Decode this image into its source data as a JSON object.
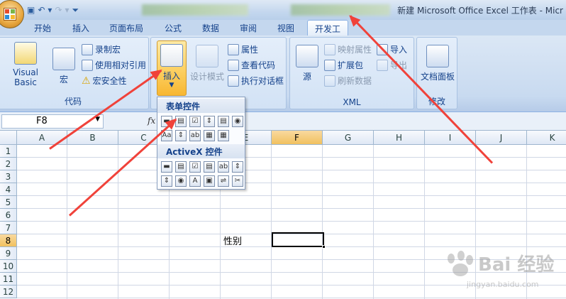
{
  "window": {
    "title": "新建 Microsoft Office Excel 工作表 - Micr"
  },
  "tabs": [
    "开始",
    "插入",
    "页面布局",
    "公式",
    "数据",
    "审阅",
    "视图",
    "开发工"
  ],
  "ribbon": {
    "code_group": {
      "label": "代码",
      "visual_basic": "Visual Basic",
      "macro": "宏",
      "record_macro": "录制宏",
      "relative_ref": "使用相对引用",
      "macro_security": "宏安全性"
    },
    "controls_group": {
      "insert": "插入",
      "design_mode": "设计模式",
      "properties": "属性",
      "view_code": "查看代码",
      "run_dialog": "执行对话框"
    },
    "xml_group": {
      "label": "XML",
      "source": "源",
      "map_props": "映射属性",
      "expansion_packs": "扩展包",
      "refresh_data": "刷新数据",
      "import": "导入",
      "export": "导出"
    },
    "modify_group": {
      "label": "修改",
      "doc_panel": "文档面板"
    }
  },
  "formula_bar": {
    "name_box": "F8",
    "fx": "fx"
  },
  "popup": {
    "form_controls": "表单控件",
    "activex_controls": "ActiveX 控件"
  },
  "sheet": {
    "columns": [
      "A",
      "B",
      "C",
      "D",
      "E",
      "F",
      "G",
      "H",
      "I",
      "J",
      "K"
    ],
    "rows": [
      "1",
      "2",
      "3",
      "4",
      "5",
      "6",
      "7",
      "8",
      "9",
      "10",
      "11",
      "12"
    ],
    "cell_E8": "性别",
    "selected_cell": "F8"
  },
  "watermark": {
    "line1": "Bai 经验",
    "line2": "jingyan.baidu.com"
  },
  "colors": {
    "arrow": "#f0423a",
    "ribbon": "#c8daf0",
    "selection": "#f1c15f"
  }
}
